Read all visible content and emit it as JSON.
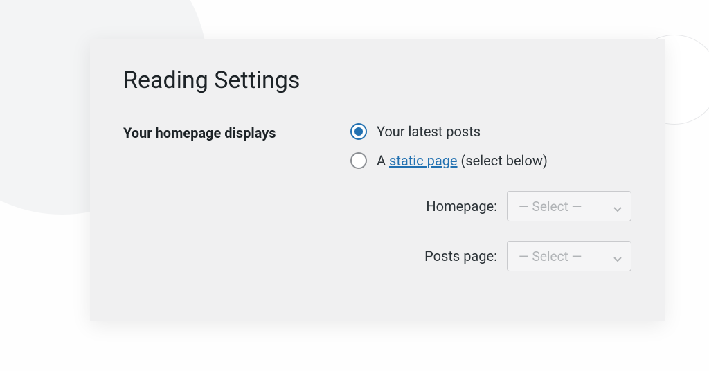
{
  "page": {
    "title": "Reading Settings"
  },
  "homepage_displays": {
    "label": "Your homepage displays",
    "options": {
      "latest": "Your latest posts",
      "static_prefix": "A ",
      "static_link": "static page",
      "static_suffix": " (select below)"
    },
    "selected": "latest"
  },
  "selects": {
    "homepage": {
      "label": "Homepage:",
      "value": "— Select —"
    },
    "posts_page": {
      "label": "Posts page:",
      "value": "— Select —"
    }
  }
}
